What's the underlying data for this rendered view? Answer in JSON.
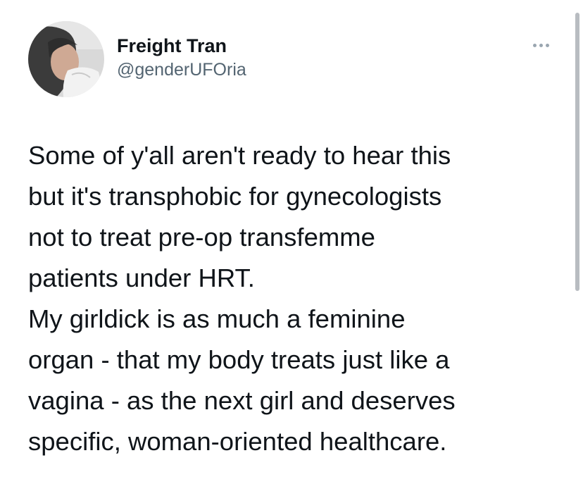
{
  "tweet": {
    "author": {
      "display_name": "Freight Tran",
      "handle": "@genderUFOria"
    },
    "more_icon": "more-horizontal-icon",
    "text_lines": [
      "Some of y'all aren't ready to hear this",
      "but it's transphobic for gynecologists",
      "not to treat pre-op transfemme",
      "patients under HRT.",
      "My girldick is as much a feminine",
      "organ - that my body treats just like a",
      "vagina - as the next girl and deserves",
      "specific, woman-oriented healthcare."
    ]
  },
  "colors": {
    "text_primary": "#0f1419",
    "text_secondary": "#536471",
    "icon_gray": "#9aa6b0",
    "scrollbar": "#b8bcc1",
    "background": "#ffffff"
  }
}
